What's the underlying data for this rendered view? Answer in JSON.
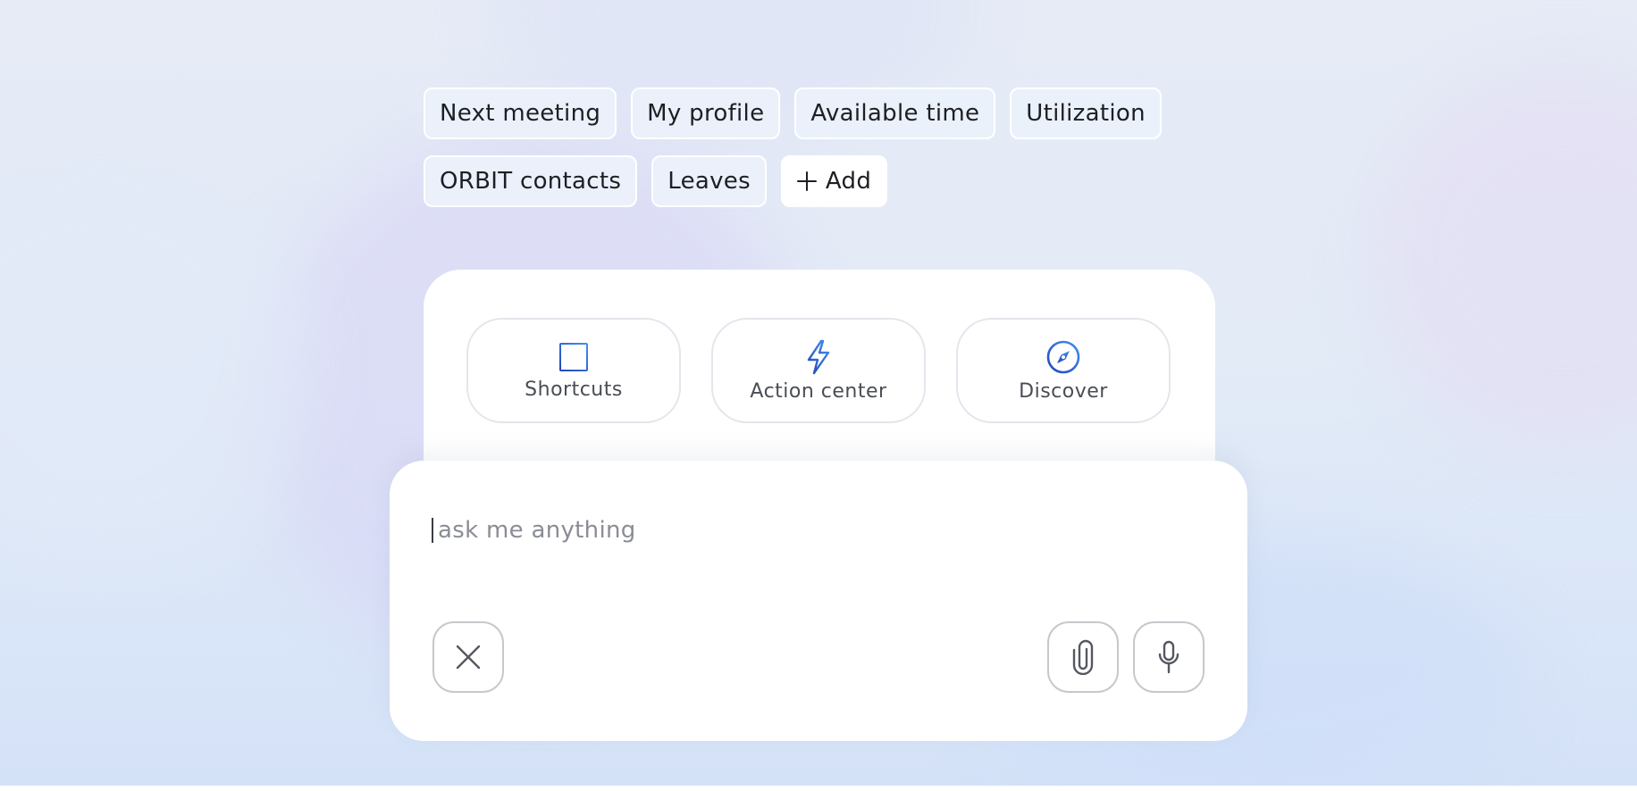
{
  "quick_chips": {
    "row1": [
      "Next meeting",
      "My profile",
      "Available time",
      "Utilization"
    ],
    "row2": [
      "ORBIT contacts",
      "Leaves"
    ],
    "add_label": "Add"
  },
  "quick_actions": [
    {
      "label": "Shortcuts",
      "icon": "grid-icon"
    },
    {
      "label": "Action center",
      "icon": "lightning-icon"
    },
    {
      "label": "Discover",
      "icon": "compass-icon"
    }
  ],
  "chat": {
    "input_value": "",
    "placeholder": "ask me anything",
    "buttons": {
      "close_icon": "close-icon",
      "attach_icon": "paperclip-icon",
      "mic_icon": "microphone-icon"
    }
  },
  "colors": {
    "accent_gradient_start": "#2547b8",
    "accent_gradient_end": "#3f8ff0",
    "chip_text": "#1d1f24",
    "placeholder": "#8a8d94"
  }
}
